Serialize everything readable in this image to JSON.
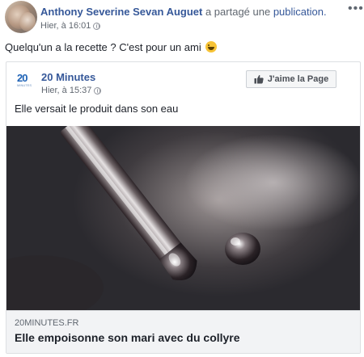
{
  "post": {
    "author": "Anthony Severine Sevan Auguet",
    "shared_text": "a partagé une",
    "publication_link": "publication.",
    "time": "Hier, à 16:01",
    "more_label": "•••",
    "caption": "Quelqu'un a la recette ? C'est pour un ami",
    "caption_emoji": "laughing-emoji"
  },
  "shared_post": {
    "page_logo": "20",
    "page_logo_sub": "MINUTES",
    "page_name": "20 Minutes",
    "time": "Hier, à 15:37",
    "like_button": "J'aime la Page",
    "text": "Elle versait le produit dans son eau"
  },
  "link_preview": {
    "domain": "20MINUTES.FR",
    "headline": "Elle empoisonne son mari avec du collyre"
  },
  "colors": {
    "link_blue": "#365899",
    "text": "#1d2129",
    "meta_gray": "#606770",
    "card_border": "#dddfe2",
    "preview_bg": "#f2f3f5"
  }
}
